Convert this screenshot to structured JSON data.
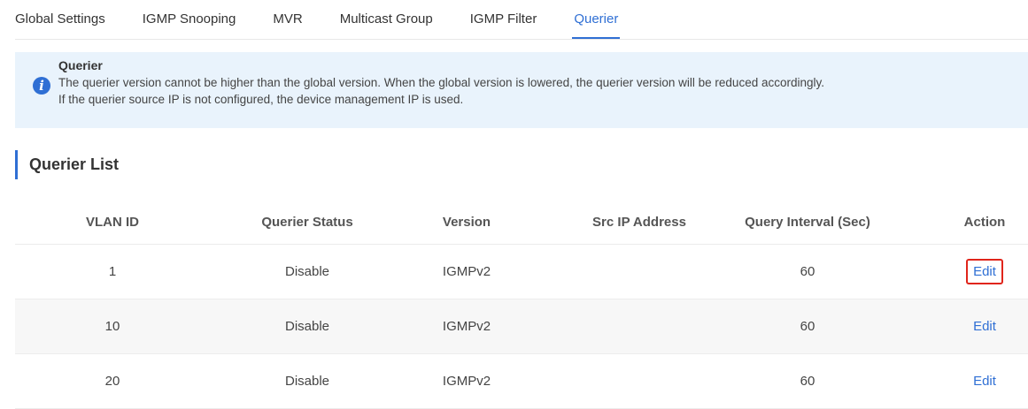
{
  "tabs": [
    {
      "label": "Global Settings",
      "active": false
    },
    {
      "label": "IGMP Snooping",
      "active": false
    },
    {
      "label": "MVR",
      "active": false
    },
    {
      "label": "Multicast Group",
      "active": false
    },
    {
      "label": "IGMP Filter",
      "active": false
    },
    {
      "label": "Querier",
      "active": true
    }
  ],
  "notice": {
    "icon": "info-icon",
    "title": "Querier",
    "line1": "The querier version cannot be higher than the global version. When the global version is lowered, the querier version will be reduced accordingly.",
    "line2": "If the querier source IP is not configured, the device management IP is used."
  },
  "section": {
    "title": "Querier List"
  },
  "table": {
    "headers": [
      "VLAN ID",
      "Querier Status",
      "Version",
      "Src IP Address",
      "Query Interval (Sec)",
      "Action"
    ],
    "rows": [
      {
        "vlan": "1",
        "status": "Disable",
        "version": "IGMPv2",
        "src_ip": "",
        "interval": "60",
        "action": "Edit"
      },
      {
        "vlan": "10",
        "status": "Disable",
        "version": "IGMPv2",
        "src_ip": "",
        "interval": "60",
        "action": "Edit"
      },
      {
        "vlan": "20",
        "status": "Disable",
        "version": "IGMPv2",
        "src_ip": "",
        "interval": "60",
        "action": "Edit"
      }
    ]
  },
  "colors": {
    "accent": "#2f6fd4",
    "highlight": "#e0251b",
    "notice_bg": "#e9f3fc"
  }
}
